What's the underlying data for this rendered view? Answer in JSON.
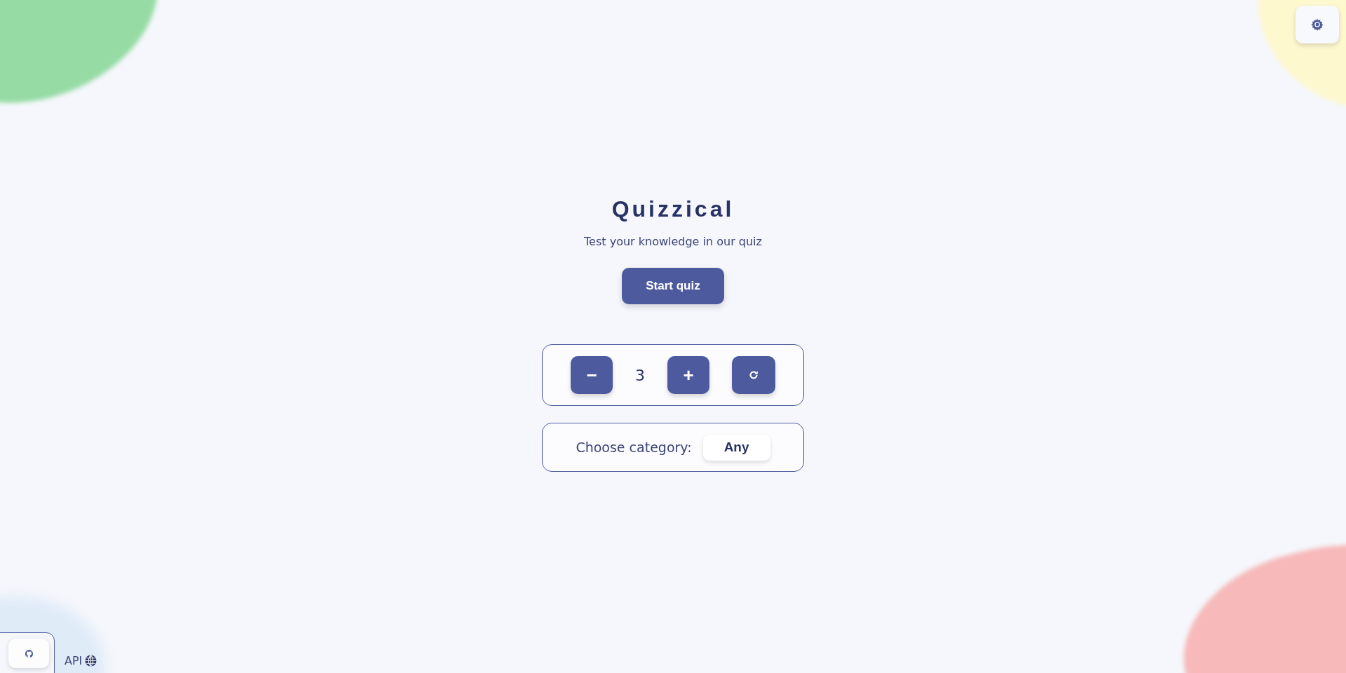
{
  "title": "Quizzical",
  "subtitle": "Test your knowledge in our quiz",
  "start_button": "Start quiz",
  "counter": {
    "decrement": "−",
    "value": "3",
    "increment": "+"
  },
  "category": {
    "label": "Choose category:",
    "value": "Any"
  },
  "footer": {
    "api_link": "API"
  }
}
